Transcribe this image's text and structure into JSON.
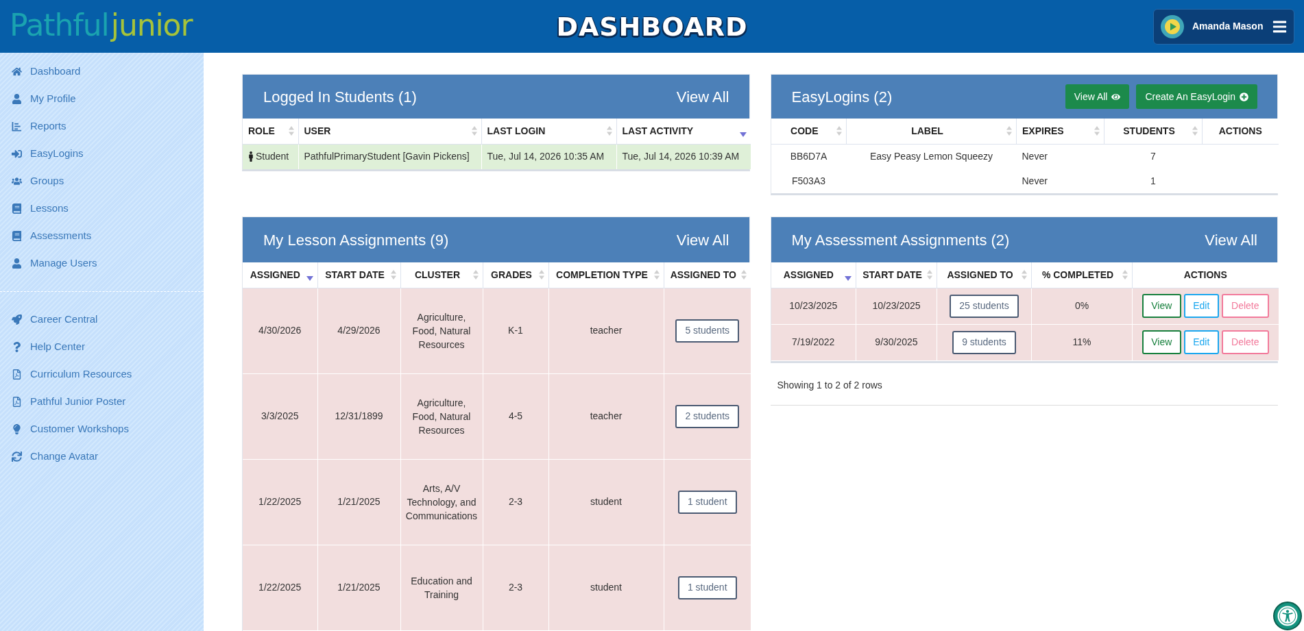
{
  "header": {
    "logo": {
      "main": "Pathful",
      "accent": "junior"
    },
    "title": "DASHBOARD",
    "user_name": "Amanda Mason"
  },
  "sidebar": {
    "groups": [
      {
        "items": [
          {
            "label": "Dashboard"
          },
          {
            "label": "My Profile"
          },
          {
            "label": "Reports"
          },
          {
            "label": "EasyLogins"
          },
          {
            "label": "Groups"
          },
          {
            "label": "Lessons"
          },
          {
            "label": "Assessments"
          },
          {
            "label": "Manage Users"
          }
        ]
      },
      {
        "items": [
          {
            "label": "Career Central"
          },
          {
            "label": "Help Center"
          },
          {
            "label": "Curriculum Resources"
          },
          {
            "label": "Pathful Junior Poster"
          },
          {
            "label": "Customer Workshops"
          },
          {
            "label": "Change Avatar"
          }
        ]
      }
    ]
  },
  "logged_in_students": {
    "title": "Logged In Students (1)",
    "link": "View All",
    "columns": [
      {
        "label": "ROLE",
        "sortable": true,
        "sorted": false
      },
      {
        "label": "USER",
        "sortable": true,
        "sorted": false
      },
      {
        "label": "LAST LOGIN",
        "sortable": true,
        "sorted": false
      },
      {
        "label": "LAST ACTIVITY",
        "sortable": true,
        "sorted": true
      }
    ],
    "rows": [
      {
        "role": "Student",
        "user": "PathfulPrimaryStudent [Gavin Pickens]",
        "last_login": "Tue, Jul 14, 2026 10:35 AM",
        "last_activity": "Tue, Jul 14, 2026 10:39 AM"
      }
    ]
  },
  "easylogins": {
    "title": "EasyLogins (2)",
    "buttons": [
      {
        "label": "View All",
        "kind": "view"
      },
      {
        "label": "Create An EasyLogin",
        "kind": "create"
      }
    ],
    "columns": [
      {
        "label": "CODE",
        "sortable": true,
        "sorted": false
      },
      {
        "label": "LABEL",
        "sortable": true,
        "sorted": false
      },
      {
        "label": "EXPIRES",
        "sortable": true,
        "sorted": false
      },
      {
        "label": "STUDENTS",
        "sortable": true,
        "sorted": false
      },
      {
        "label": "ACTIONS",
        "sortable": false,
        "sorted": false
      }
    ],
    "rows": [
      {
        "code": "BB6D7A",
        "label": "Easy Peasy Lemon Squeezy",
        "expires": "Never",
        "students": "7"
      },
      {
        "code": "F503A3",
        "expires": "Never",
        "students": "1"
      }
    ]
  },
  "lesson_assignments": {
    "title": "My Lesson Assignments (9)",
    "link": "View All",
    "columns": [
      {
        "label": "ASSIGNED",
        "sortable": true,
        "sorted": true
      },
      {
        "label": "START DATE",
        "sortable": true,
        "sorted": false
      },
      {
        "label": "CLUSTER",
        "sortable": true,
        "sorted": false
      },
      {
        "label": "GRADES",
        "sortable": true,
        "sorted": false
      },
      {
        "label": "COMPLETION TYPE",
        "sortable": true,
        "sorted": false
      },
      {
        "label": "ASSIGNED TO",
        "sortable": true,
        "sorted": false
      }
    ],
    "rows": [
      {
        "assigned": "4/30/2026",
        "start_date": "4/29/2026",
        "cluster": "Agriculture, Food, Natural Resources",
        "grades": "K-1",
        "completion_type": "teacher",
        "assigned_to": "5 students"
      },
      {
        "assigned": "3/3/2025",
        "start_date": "12/31/1899",
        "cluster": "Agriculture, Food, Natural Resources",
        "grades": "4-5",
        "completion_type": "teacher",
        "assigned_to": "2 students"
      },
      {
        "assigned": "1/22/2025",
        "start_date": "1/21/2025",
        "cluster": "Arts, A/V Technology, and Communications",
        "grades": "2-3",
        "completion_type": "student",
        "assigned_to": "1 student"
      },
      {
        "assigned": "1/22/2025",
        "start_date": "1/21/2025",
        "cluster": "Education and Training",
        "grades": "2-3",
        "completion_type": "student",
        "assigned_to": "1 student"
      }
    ]
  },
  "assessment_assignments": {
    "title": "My Assessment Assignments (2)",
    "link": "View All",
    "columns": [
      {
        "label": "ASSIGNED",
        "sortable": true,
        "sorted": true
      },
      {
        "label": "START DATE",
        "sortable": true,
        "sorted": false
      },
      {
        "label": "ASSIGNED TO",
        "sortable": true,
        "sorted": false
      },
      {
        "label": "% COMPLETED",
        "sortable": true,
        "sorted": false
      },
      {
        "label": "ACTIONS",
        "sortable": false,
        "sorted": false
      }
    ],
    "rows": [
      {
        "assigned": "10/23/2025",
        "start_date": "10/23/2025",
        "assigned_to": "25 students",
        "completed": "0%",
        "actions": [
          {
            "label": "View",
            "kind": "view"
          },
          {
            "label": "Edit",
            "kind": "edit"
          },
          {
            "label": "Delete",
            "kind": "delete"
          }
        ]
      },
      {
        "assigned": "7/19/2022",
        "start_date": "9/30/2025",
        "assigned_to": "9 students",
        "completed": "11%",
        "actions": [
          {
            "label": "View",
            "kind": "view"
          },
          {
            "label": "Edit",
            "kind": "edit"
          },
          {
            "label": "Delete",
            "kind": "delete"
          }
        ]
      }
    ],
    "footer": "Showing 1 to 2 of 2 rows"
  }
}
